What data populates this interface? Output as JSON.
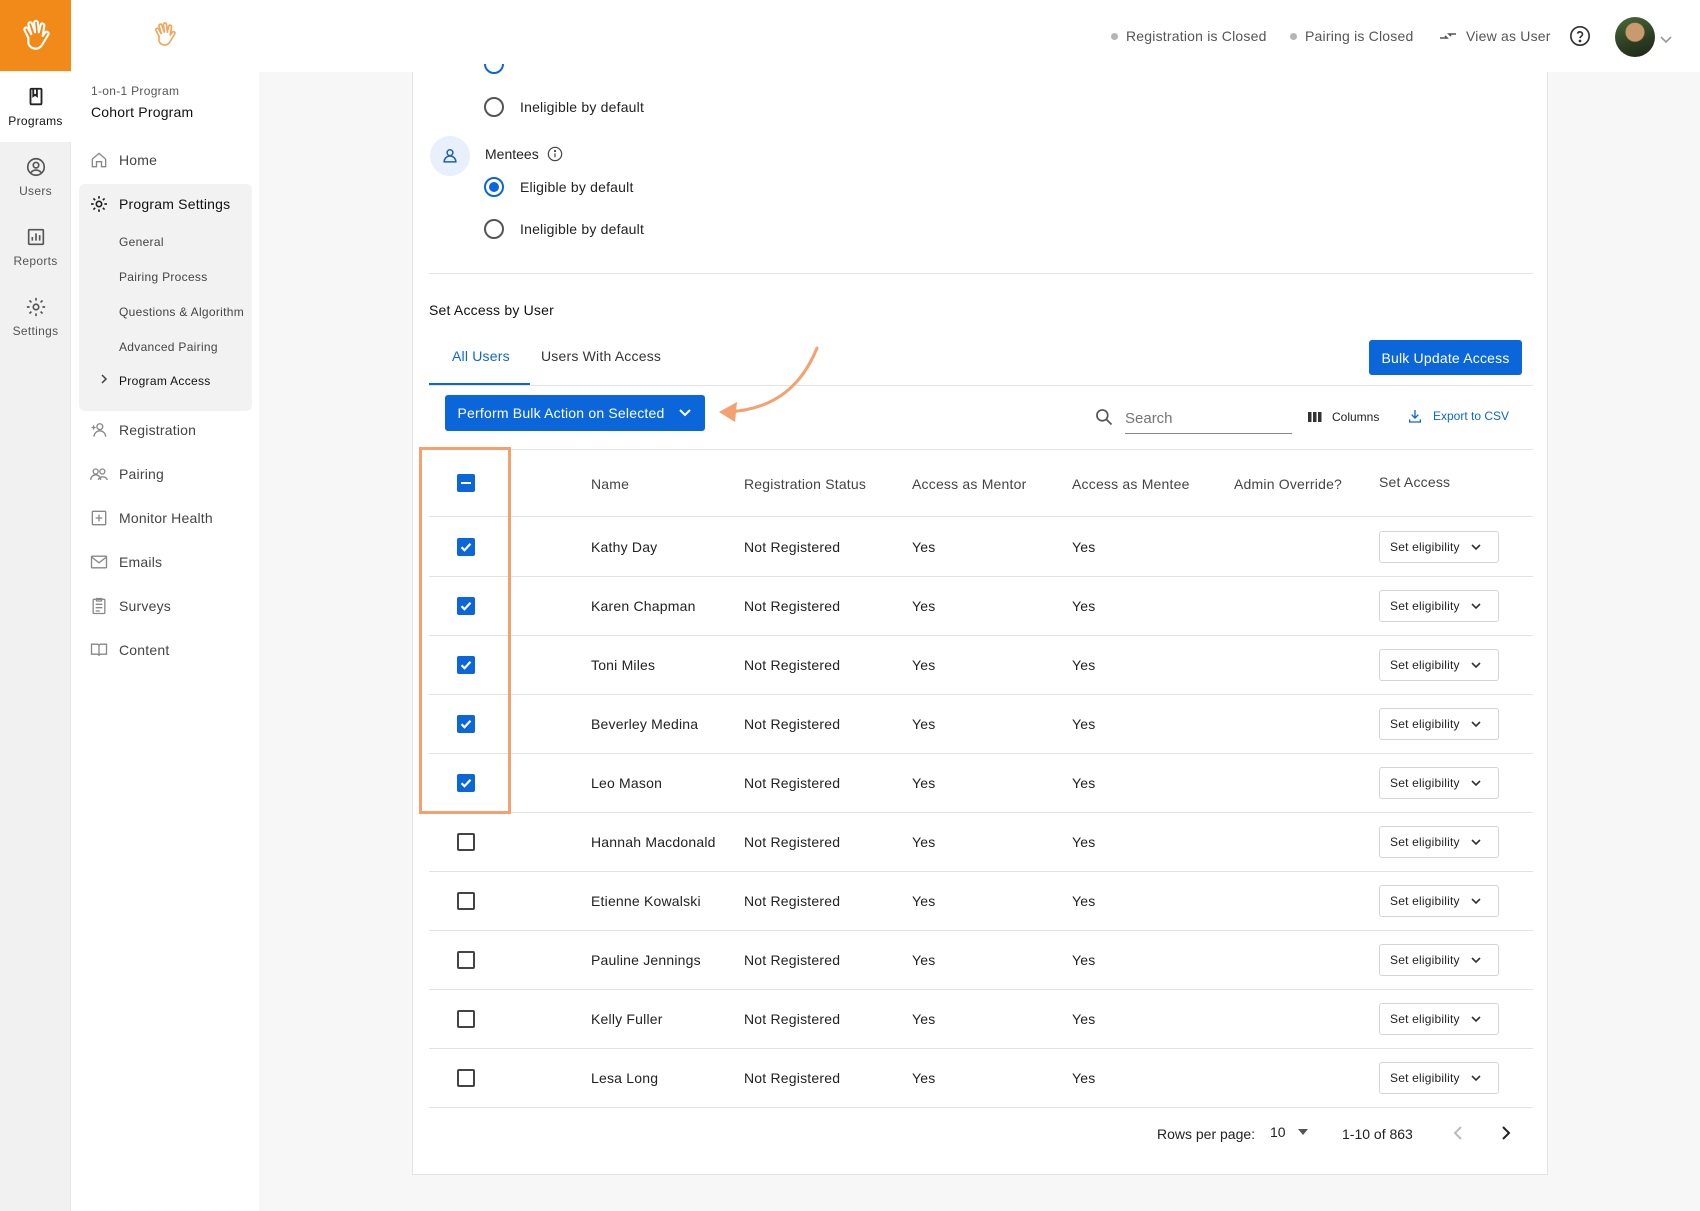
{
  "rail": {
    "items": [
      {
        "label": "Programs",
        "icon": "book-icon",
        "active": true
      },
      {
        "label": "Users",
        "icon": "user-circle-icon",
        "active": false
      },
      {
        "label": "Reports",
        "icon": "chart-icon",
        "active": false
      },
      {
        "label": "Settings",
        "icon": "gear-icon",
        "active": false
      }
    ]
  },
  "nav": {
    "program_type": "1-on-1 Program",
    "program_name": "Cohort Program",
    "home": "Home",
    "program_settings": "Program Settings",
    "sub_items": [
      "General",
      "Pairing Process",
      "Questions & Algorithm",
      "Advanced Pairing",
      "Program Access"
    ],
    "registration": "Registration",
    "pairing": "Pairing",
    "monitor_health": "Monitor Health",
    "emails": "Emails",
    "surveys": "Surveys",
    "content": "Content"
  },
  "topbar": {
    "registration_status": "Registration is Closed",
    "pairing_status": "Pairing is Closed",
    "view_as_user": "View as User"
  },
  "eligibility": {
    "mentors_ineligible": "Ineligible by default",
    "mentees_title": "Mentees",
    "mentees_eligible": "Eligible by default",
    "mentees_ineligible": "Ineligible by default"
  },
  "access": {
    "section_title": "Set Access by User",
    "tabs": [
      "All Users",
      "Users With Access"
    ],
    "bulk_update_button": "Bulk Update Access",
    "bulk_action_button": "Perform Bulk Action on Selected",
    "search_placeholder": "Search",
    "columns_button": "Columns",
    "export_button": "Export to CSV"
  },
  "table": {
    "headers": [
      "Name",
      "Registration Status",
      "Access as Mentor",
      "Access as Mentee",
      "Admin Override?",
      "Set Access"
    ],
    "set_eligibility_label": "Set eligibility",
    "rows": [
      {
        "name": "Kathy Day",
        "status": "Not Registered",
        "mentor": "Yes",
        "mentee": "Yes",
        "selected": true
      },
      {
        "name": "Karen Chapman",
        "status": "Not Registered",
        "mentor": "Yes",
        "mentee": "Yes",
        "selected": true
      },
      {
        "name": "Toni Miles",
        "status": "Not Registered",
        "mentor": "Yes",
        "mentee": "Yes",
        "selected": true
      },
      {
        "name": "Beverley Medina",
        "status": "Not Registered",
        "mentor": "Yes",
        "mentee": "Yes",
        "selected": true
      },
      {
        "name": "Leo Mason",
        "status": "Not Registered",
        "mentor": "Yes",
        "mentee": "Yes",
        "selected": true
      },
      {
        "name": "Hannah Macdonald",
        "status": "Not Registered",
        "mentor": "Yes",
        "mentee": "Yes",
        "selected": false
      },
      {
        "name": "Etienne Kowalski",
        "status": "Not Registered",
        "mentor": "Yes",
        "mentee": "Yes",
        "selected": false
      },
      {
        "name": "Pauline Jennings",
        "status": "Not Registered",
        "mentor": "Yes",
        "mentee": "Yes",
        "selected": false
      },
      {
        "name": "Kelly Fuller",
        "status": "Not Registered",
        "mentor": "Yes",
        "mentee": "Yes",
        "selected": false
      },
      {
        "name": "Lesa Long",
        "status": "Not Registered",
        "mentor": "Yes",
        "mentee": "Yes",
        "selected": false
      }
    ]
  },
  "pagination": {
    "rows_per_page_label": "Rows per page:",
    "rows_per_page": "10",
    "range": "1-10 of 863"
  },
  "colors": {
    "accent": "#0a66d9",
    "brand": "#f28a1a",
    "annotation": "#f5a06f"
  }
}
